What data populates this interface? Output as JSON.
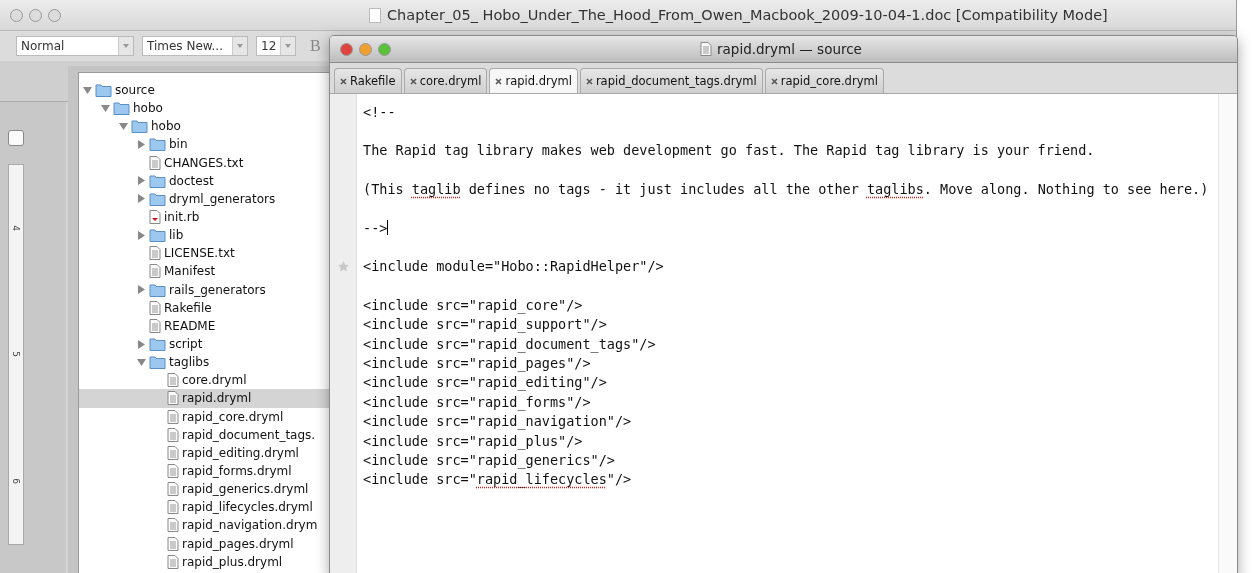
{
  "word_window": {
    "title": "Chapter_05_ Hobo_Under_The_Hood_From_Owen_Macbook_2009-10-04-1.doc [Compatibility Mode]",
    "style_select": "Normal",
    "font_select": "Times New...",
    "size_select": "12",
    "bold_button": "B",
    "ruler_marks": [
      "4",
      "5",
      "6"
    ]
  },
  "project_tree": [
    {
      "label": "source",
      "kind": "folder",
      "expanded": true,
      "selected": false,
      "children": [
        {
          "label": "hobo",
          "kind": "folder",
          "expanded": true,
          "selected": false,
          "children": [
            {
              "label": "hobo",
              "kind": "folder",
              "expanded": true,
              "selected": false,
              "children": [
                {
                  "label": "bin",
                  "kind": "folder",
                  "expanded": false,
                  "selected": false
                },
                {
                  "label": "CHANGES.txt",
                  "kind": "file",
                  "selected": false
                },
                {
                  "label": "doctest",
                  "kind": "folder",
                  "expanded": false,
                  "selected": false
                },
                {
                  "label": "dryml_generators",
                  "kind": "folder",
                  "expanded": false,
                  "selected": false
                },
                {
                  "label": "init.rb",
                  "kind": "ruby",
                  "selected": false
                },
                {
                  "label": "lib",
                  "kind": "folder",
                  "expanded": false,
                  "selected": false
                },
                {
                  "label": "LICENSE.txt",
                  "kind": "file",
                  "selected": false
                },
                {
                  "label": "Manifest",
                  "kind": "file",
                  "selected": false
                },
                {
                  "label": "rails_generators",
                  "kind": "folder",
                  "expanded": false,
                  "selected": false
                },
                {
                  "label": "Rakefile",
                  "kind": "file",
                  "selected": false
                },
                {
                  "label": "README",
                  "kind": "file",
                  "selected": false
                },
                {
                  "label": "script",
                  "kind": "folder",
                  "expanded": false,
                  "selected": false
                },
                {
                  "label": "taglibs",
                  "kind": "folder",
                  "expanded": true,
                  "selected": false,
                  "children": [
                    {
                      "label": "core.dryml",
                      "kind": "file",
                      "selected": false
                    },
                    {
                      "label": "rapid.dryml",
                      "kind": "file",
                      "selected": true
                    },
                    {
                      "label": "rapid_core.dryml",
                      "kind": "file",
                      "selected": false
                    },
                    {
                      "label": "rapid_document_tags.",
                      "kind": "file",
                      "selected": false
                    },
                    {
                      "label": "rapid_editing.dryml",
                      "kind": "file",
                      "selected": false
                    },
                    {
                      "label": "rapid_forms.dryml",
                      "kind": "file",
                      "selected": false
                    },
                    {
                      "label": "rapid_generics.dryml",
                      "kind": "file",
                      "selected": false
                    },
                    {
                      "label": "rapid_lifecycles.dryml",
                      "kind": "file",
                      "selected": false
                    },
                    {
                      "label": "rapid_navigation.drym",
                      "kind": "file",
                      "selected": false
                    },
                    {
                      "label": "rapid_pages.dryml",
                      "kind": "file",
                      "selected": false
                    },
                    {
                      "label": "rapid_plus.dryml",
                      "kind": "file",
                      "selected": false
                    }
                  ]
                }
              ]
            }
          ]
        }
      ]
    }
  ],
  "editor": {
    "title": "rapid.dryml — source",
    "tabs": [
      {
        "label": "Rakefile",
        "selected": false
      },
      {
        "label": "core.dryml",
        "selected": false
      },
      {
        "label": "rapid.dryml",
        "selected": true
      },
      {
        "label": "rapid_document_tags.dryml",
        "selected": false
      },
      {
        "label": "rapid_core.dryml",
        "selected": false
      }
    ],
    "lines": [
      {
        "kind": "text",
        "bookmarked": false,
        "cursor": false,
        "segments": [
          {
            "text": "<!--",
            "misspelled": false
          }
        ]
      },
      {
        "kind": "blank"
      },
      {
        "kind": "text",
        "bookmarked": false,
        "cursor": false,
        "segments": [
          {
            "text": "The Rapid tag library makes web development go fast. The Rapid tag library is your friend.",
            "misspelled": false
          }
        ]
      },
      {
        "kind": "blank"
      },
      {
        "kind": "text",
        "bookmarked": false,
        "cursor": false,
        "segments": [
          {
            "text": "(This ",
            "misspelled": false
          },
          {
            "text": "taglib",
            "misspelled": true
          },
          {
            "text": " defines no tags - it just includes all the other ",
            "misspelled": false
          },
          {
            "text": "taglibs",
            "misspelled": true
          },
          {
            "text": ". Move along. Nothing to see here.)",
            "misspelled": false
          }
        ]
      },
      {
        "kind": "blank"
      },
      {
        "kind": "text",
        "bookmarked": false,
        "cursor": true,
        "segments": [
          {
            "text": "-->",
            "misspelled": false
          }
        ]
      },
      {
        "kind": "blank"
      },
      {
        "kind": "text",
        "bookmarked": true,
        "cursor": false,
        "segments": [
          {
            "text": "<include module=\"Hobo::RapidHelper\"/>",
            "misspelled": false
          }
        ]
      },
      {
        "kind": "blank"
      },
      {
        "kind": "text",
        "bookmarked": false,
        "cursor": false,
        "segments": [
          {
            "text": "<include src=\"rapid_core\"/>",
            "misspelled": false
          }
        ]
      },
      {
        "kind": "text",
        "bookmarked": false,
        "cursor": false,
        "segments": [
          {
            "text": "<include src=\"rapid_support\"/>",
            "misspelled": false
          }
        ]
      },
      {
        "kind": "text",
        "bookmarked": false,
        "cursor": false,
        "segments": [
          {
            "text": "<include src=\"rapid_document_tags\"/>",
            "misspelled": false
          }
        ]
      },
      {
        "kind": "text",
        "bookmarked": false,
        "cursor": false,
        "segments": [
          {
            "text": "<include src=\"rapid_pages\"/>",
            "misspelled": false
          }
        ]
      },
      {
        "kind": "text",
        "bookmarked": false,
        "cursor": false,
        "segments": [
          {
            "text": "<include src=\"rapid_editing\"/>",
            "misspelled": false
          }
        ]
      },
      {
        "kind": "text",
        "bookmarked": false,
        "cursor": false,
        "segments": [
          {
            "text": "<include src=\"rapid_forms\"/>",
            "misspelled": false
          }
        ]
      },
      {
        "kind": "text",
        "bookmarked": false,
        "cursor": false,
        "segments": [
          {
            "text": "<include src=\"rapid_navigation\"/>",
            "misspelled": false
          }
        ]
      },
      {
        "kind": "text",
        "bookmarked": false,
        "cursor": false,
        "segments": [
          {
            "text": "<include src=\"rapid_plus\"/>",
            "misspelled": false
          }
        ]
      },
      {
        "kind": "text",
        "bookmarked": false,
        "cursor": false,
        "segments": [
          {
            "text": "<include src=\"rapid_generics\"/>",
            "misspelled": false
          }
        ]
      },
      {
        "kind": "text",
        "bookmarked": false,
        "cursor": false,
        "segments": [
          {
            "text": "<include src=\"",
            "misspelled": false
          },
          {
            "text": "rapid_lifecycles",
            "misspelled": true
          },
          {
            "text": "\"/>",
            "misspelled": false
          }
        ]
      }
    ]
  }
}
